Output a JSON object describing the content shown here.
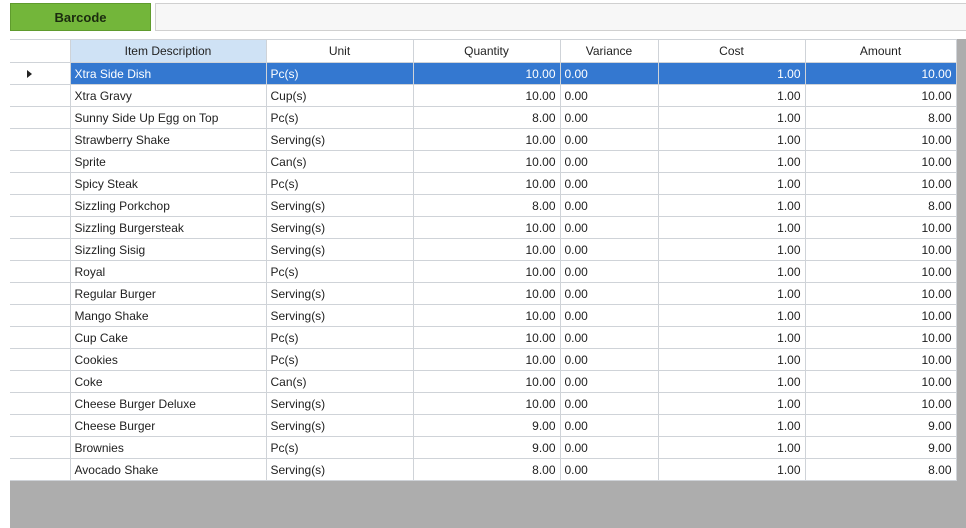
{
  "toolbar": {
    "barcode_label": "Barcode",
    "barcode_value": ""
  },
  "grid": {
    "columns": [
      "Item Description",
      "Unit",
      "Quantity",
      "Variance",
      "Cost",
      "Amount"
    ],
    "sorted_column": "Item Description",
    "selected_row": 0,
    "rows": [
      {
        "item": "Xtra Side Dish",
        "unit": "Pc(s)",
        "quantity": "10.00",
        "variance": "0.00",
        "cost": "1.00",
        "amount": "10.00"
      },
      {
        "item": "Xtra Gravy",
        "unit": "Cup(s)",
        "quantity": "10.00",
        "variance": "0.00",
        "cost": "1.00",
        "amount": "10.00"
      },
      {
        "item": "Sunny Side Up Egg on Top",
        "unit": "Pc(s)",
        "quantity": "8.00",
        "variance": "0.00",
        "cost": "1.00",
        "amount": "8.00"
      },
      {
        "item": "Strawberry Shake",
        "unit": "Serving(s)",
        "quantity": "10.00",
        "variance": "0.00",
        "cost": "1.00",
        "amount": "10.00"
      },
      {
        "item": "Sprite",
        "unit": "Can(s)",
        "quantity": "10.00",
        "variance": "0.00",
        "cost": "1.00",
        "amount": "10.00"
      },
      {
        "item": "Spicy Steak",
        "unit": "Pc(s)",
        "quantity": "10.00",
        "variance": "0.00",
        "cost": "1.00",
        "amount": "10.00"
      },
      {
        "item": "Sizzling Porkchop",
        "unit": "Serving(s)",
        "quantity": "8.00",
        "variance": "0.00",
        "cost": "1.00",
        "amount": "8.00"
      },
      {
        "item": "Sizzling Burgersteak",
        "unit": "Serving(s)",
        "quantity": "10.00",
        "variance": "0.00",
        "cost": "1.00",
        "amount": "10.00"
      },
      {
        "item": "Sizzling  Sisig",
        "unit": "Serving(s)",
        "quantity": "10.00",
        "variance": "0.00",
        "cost": "1.00",
        "amount": "10.00"
      },
      {
        "item": "Royal",
        "unit": "Pc(s)",
        "quantity": "10.00",
        "variance": "0.00",
        "cost": "1.00",
        "amount": "10.00"
      },
      {
        "item": "Regular Burger",
        "unit": "Serving(s)",
        "quantity": "10.00",
        "variance": "0.00",
        "cost": "1.00",
        "amount": "10.00"
      },
      {
        "item": "Mango Shake",
        "unit": "Serving(s)",
        "quantity": "10.00",
        "variance": "0.00",
        "cost": "1.00",
        "amount": "10.00"
      },
      {
        "item": "Cup Cake",
        "unit": "Pc(s)",
        "quantity": "10.00",
        "variance": "0.00",
        "cost": "1.00",
        "amount": "10.00"
      },
      {
        "item": "Cookies",
        "unit": "Pc(s)",
        "quantity": "10.00",
        "variance": "0.00",
        "cost": "1.00",
        "amount": "10.00"
      },
      {
        "item": "Coke",
        "unit": "Can(s)",
        "quantity": "10.00",
        "variance": "0.00",
        "cost": "1.00",
        "amount": "10.00"
      },
      {
        "item": "Cheese Burger Deluxe",
        "unit": "Serving(s)",
        "quantity": "10.00",
        "variance": "0.00",
        "cost": "1.00",
        "amount": "10.00"
      },
      {
        "item": "Cheese Burger",
        "unit": "Serving(s)",
        "quantity": "9.00",
        "variance": "0.00",
        "cost": "1.00",
        "amount": "9.00"
      },
      {
        "item": "Brownies",
        "unit": "Pc(s)",
        "quantity": "9.00",
        "variance": "0.00",
        "cost": "1.00",
        "amount": "9.00"
      },
      {
        "item": "Avocado Shake",
        "unit": "Serving(s)",
        "quantity": "8.00",
        "variance": "0.00",
        "cost": "1.00",
        "amount": "8.00"
      }
    ]
  },
  "colors": {
    "barcode_button": "#73b63a",
    "selected_row": "#3478d0",
    "sorted_header": "#cfe2f5",
    "grid_background": "#adadad"
  }
}
